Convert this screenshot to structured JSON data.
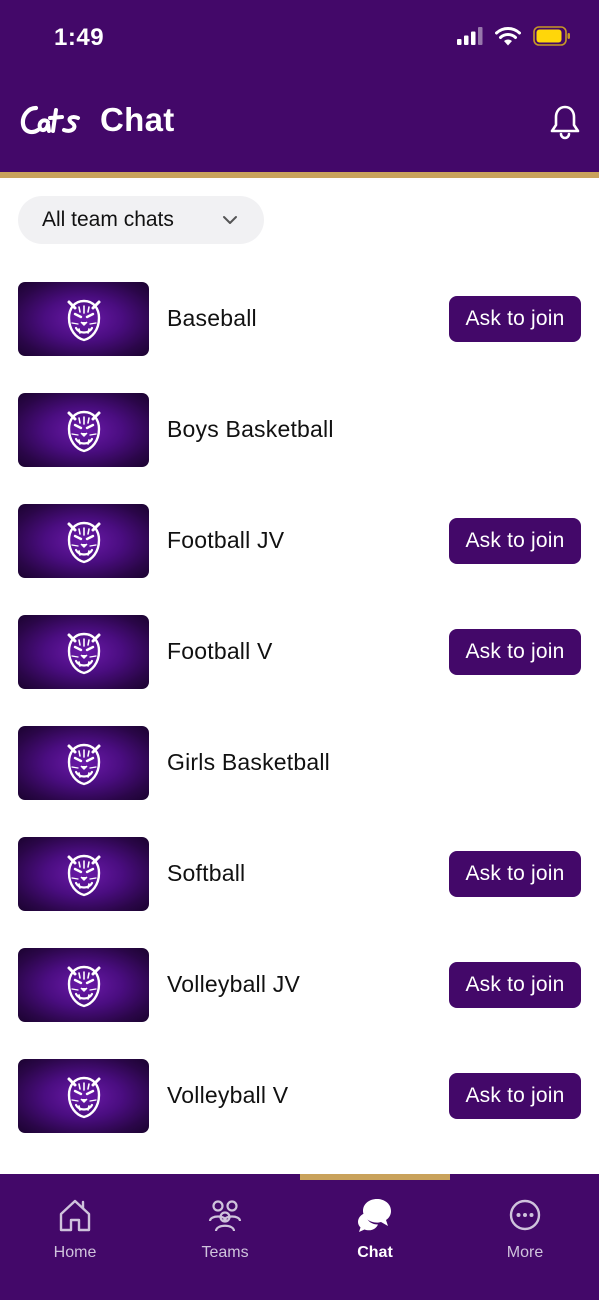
{
  "status_bar": {
    "time": "1:49"
  },
  "header": {
    "title": "Chat",
    "logo_text": "Cats"
  },
  "filter": {
    "label": "All team chats"
  },
  "teams": [
    {
      "name": "Baseball",
      "action": "Ask to join"
    },
    {
      "name": "Boys Basketball",
      "action": ""
    },
    {
      "name": "Football JV",
      "action": "Ask to join"
    },
    {
      "name": "Football V",
      "action": "Ask to join"
    },
    {
      "name": "Girls Basketball",
      "action": ""
    },
    {
      "name": "Softball",
      "action": "Ask to join"
    },
    {
      "name": "Volleyball JV",
      "action": "Ask to join"
    },
    {
      "name": "Volleyball V",
      "action": "Ask to join"
    }
  ],
  "tabs": [
    {
      "label": "Home",
      "icon": "home-icon"
    },
    {
      "label": "Teams",
      "icon": "people-icon"
    },
    {
      "label": "Chat",
      "icon": "chat-icon",
      "active": true
    },
    {
      "label": "More",
      "icon": "more-icon"
    }
  ],
  "colors": {
    "primary": "#430869",
    "accent": "#c9a25b",
    "battery": "#ffd60a"
  }
}
